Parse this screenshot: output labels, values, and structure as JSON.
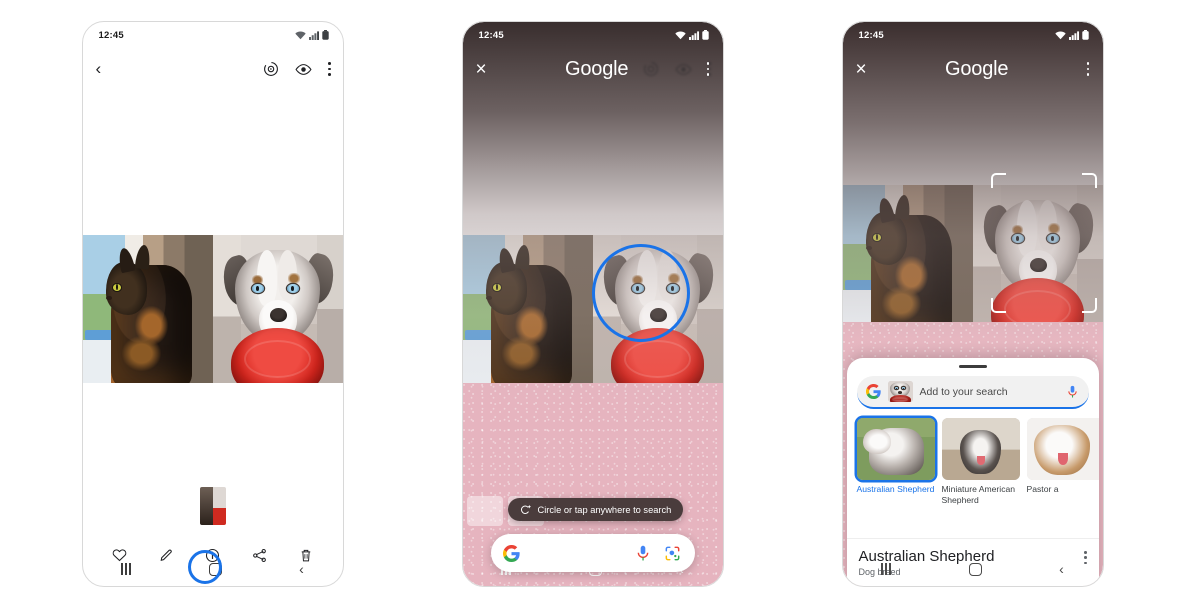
{
  "status_bar": {
    "time": "12:45",
    "icons": [
      "wifi-icon",
      "cellular-signal-icon",
      "battery-icon"
    ]
  },
  "panels": [
    {
      "id": "panel-gallery",
      "app_bar": {
        "back_label": "‹",
        "icons": [
          "motion-photo-icon",
          "view-icon",
          "overflow-menu-icon"
        ]
      },
      "toolbar": {
        "items": [
          {
            "name": "favorite-button",
            "icon": "heart-icon"
          },
          {
            "name": "edit-button",
            "icon": "pencil-icon"
          },
          {
            "name": "info-button",
            "icon": "info-icon"
          },
          {
            "name": "share-button",
            "icon": "share-icon"
          },
          {
            "name": "delete-button",
            "icon": "trash-icon"
          }
        ]
      },
      "photos": [
        {
          "name": "cat-photo",
          "alt": "Tortoiseshell cat sitting at a window"
        },
        {
          "name": "dog-photo",
          "alt": "Australian Shepherd holding a red frisbee"
        }
      ],
      "highlight": {
        "target": "home-button",
        "color": "#1a73e8"
      },
      "nav_bar": {
        "recents": "recents-icon",
        "home": "home-icon",
        "back": "‹"
      }
    },
    {
      "id": "panel-circle-to-search",
      "google_bar": {
        "close_label": "×",
        "title": "Google",
        "overflow": "overflow-menu-icon"
      },
      "tooltip": {
        "icon": "circle-to-search-icon",
        "text": "Circle or tap anywhere to search"
      },
      "search_pill": {
        "google_icon": "google-g-icon",
        "mic_icon": "microphone-icon",
        "lens_icon": "google-lens-icon",
        "value": "",
        "placeholder": ""
      },
      "selection": {
        "shape": "circle",
        "color": "#1a73e8",
        "target": "dog-head"
      },
      "nav_bar": {
        "recents": "recents-icon",
        "home": "home-icon",
        "back": "‹"
      }
    },
    {
      "id": "panel-search-results",
      "google_bar": {
        "close_label": "×",
        "title": "Google",
        "overflow": "overflow-menu-icon"
      },
      "crop_frame": {
        "name": "crop-selection-frame",
        "color": "#ffffff"
      },
      "sheet": {
        "grabber": "drag-handle",
        "add_search": {
          "google_icon": "google-g-icon",
          "thumbnail": "cropped-dog-thumbnail",
          "placeholder": "Add to your search",
          "mic_icon": "microphone-icon",
          "value": ""
        },
        "results": [
          {
            "label": "Australian Shepherd",
            "selected": true,
            "thumb": "australian-shepherd-thumb"
          },
          {
            "label": "Miniature American Shepherd",
            "selected": false,
            "thumb": "miniature-american-shepherd-thumb"
          },
          {
            "label": "Pastor a",
            "selected": false,
            "thumb": "pastor-australiano-thumb"
          }
        ],
        "knowledge_panel": {
          "title": "Australian Shepherd",
          "subtitle": "Dog breed",
          "overflow": "overflow-menu-icon"
        }
      },
      "nav_bar": {
        "recents": "recents-icon",
        "home": "home-icon",
        "back": "‹"
      }
    }
  ],
  "colors": {
    "accent_blue": "#1a73e8",
    "pink_bg": "#e6b4bf",
    "frisbee_red": "#d5251d"
  }
}
